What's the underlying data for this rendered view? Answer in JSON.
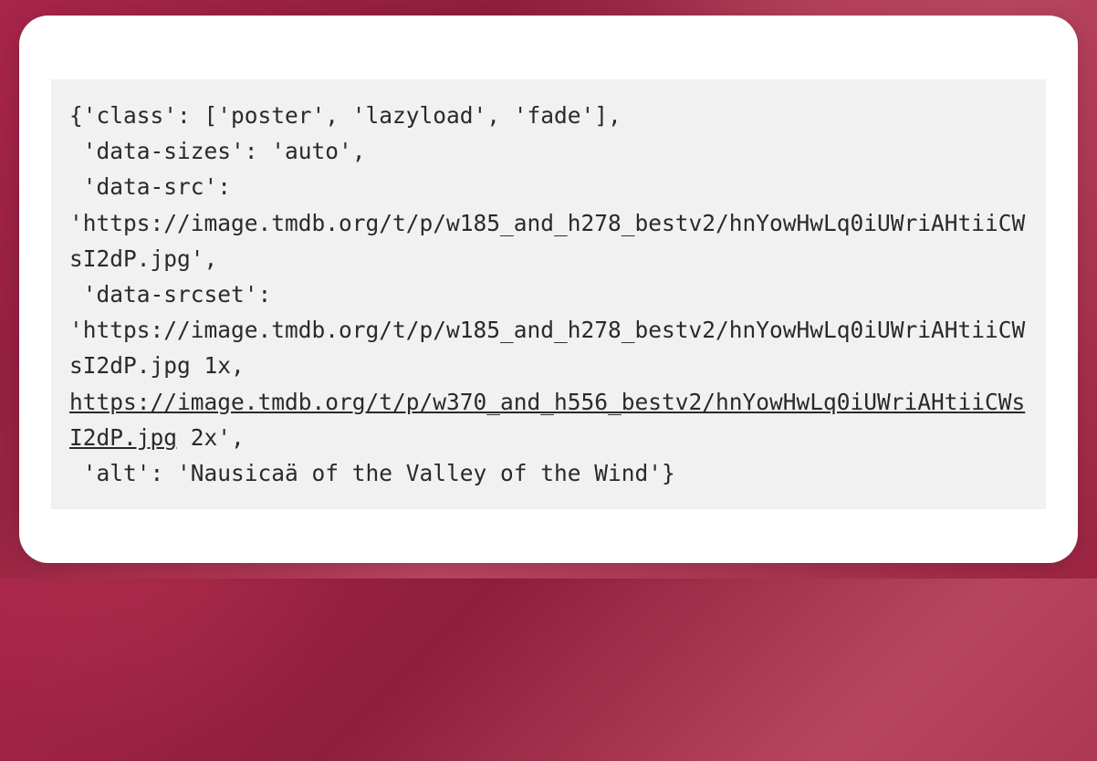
{
  "code": {
    "line1": "{'class': ['poster', 'lazyload', 'fade'],",
    "line2": " 'data-sizes': 'auto',",
    "line3": " 'data-src':",
    "line4": "'https://image.tmdb.org/t/p/w185_and_h278_bestv2/hnYowHwLq0iUWriAHtiiCWsI2dP.jpg',",
    "line5": " 'data-srcset':",
    "line6": "'https://image.tmdb.org/t/p/w185_and_h278_bestv2/hnYowHwLq0iUWriAHtiiCWsI2dP.jpg 1x,",
    "line7_underlined": "https://image.tmdb.org/t/p/w370_and_h556_bestv2/hnYowHwLq0iUWriAHtiiCWsI2dP.jpg",
    "line7_suffix": " 2x',",
    "line8": " 'alt': 'Nausicaä of the Valley of the Wind'}"
  }
}
